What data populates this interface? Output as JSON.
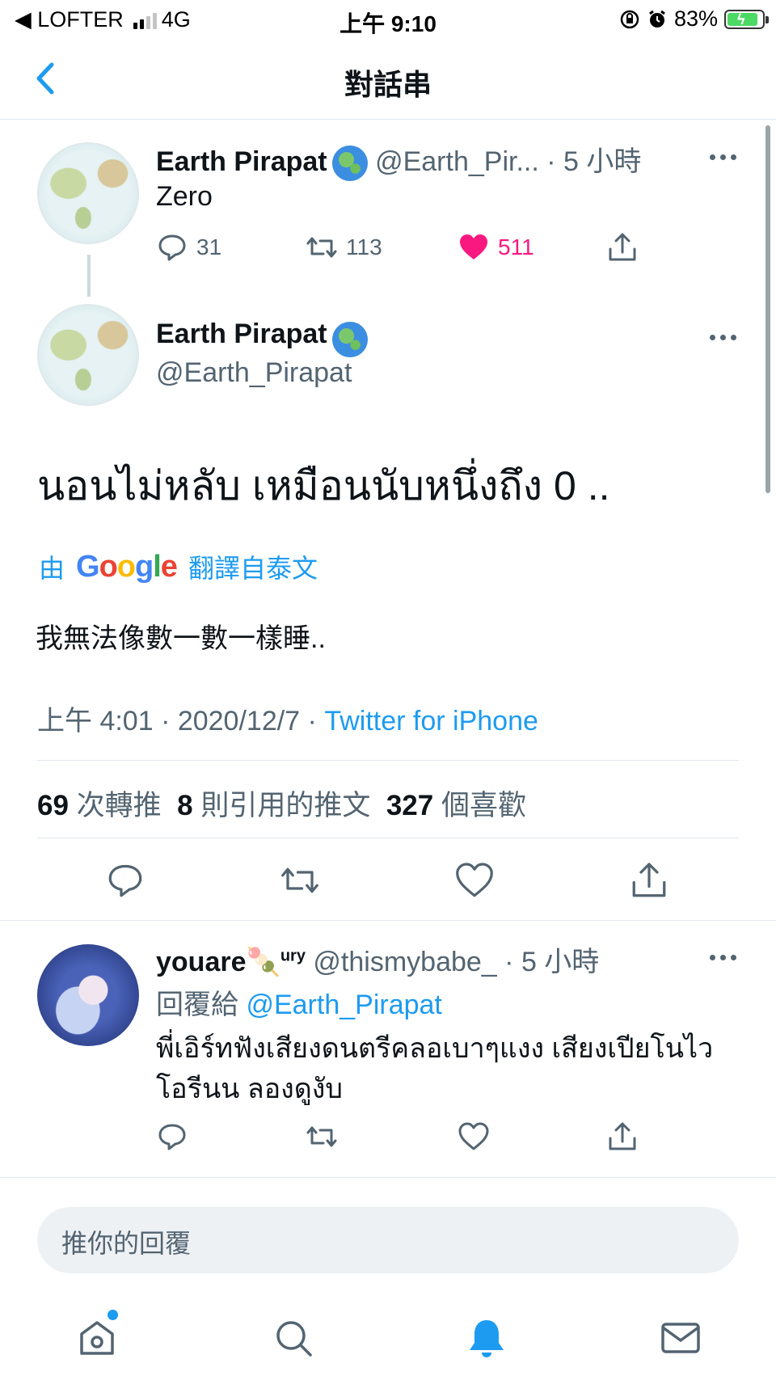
{
  "status_bar": {
    "carrier": "◀ LOFTER",
    "network": "4G",
    "time": "上午 9:10",
    "battery": "83%"
  },
  "nav": {
    "title": "對話串"
  },
  "thread_tweet": {
    "name": "Earth Pirapat",
    "handle": "@Earth_Pir...",
    "time": "· 5 小時",
    "text": "Zero",
    "replies": "31",
    "retweets": "113",
    "likes": "511"
  },
  "main_tweet": {
    "name": "Earth Pirapat",
    "handle": "@Earth_Pirapat",
    "text": "นอนไม่หลับ เหมือนนับหนึ่งถึง 0 ..",
    "translate_prefix": "由",
    "translate_brand": "Google",
    "translate_suffix": "翻譯自泰文",
    "translation": "我無法像數一數一樣睡..",
    "timestamp": "上午 4:01 · 2020/12/7 ·",
    "source": "Twitter for iPhone",
    "stats": {
      "retweets_count": "69",
      "retweets_label": "次轉推",
      "quotes_count": "8",
      "quotes_label": "則引用的推文",
      "likes_count": "327",
      "likes_label": "個喜歡"
    }
  },
  "reply_tweet": {
    "name": "youare",
    "emoji": "🍡",
    "name_suffix": "ury",
    "handle": "@thismybabe_",
    "time": "· 5 小時",
    "reply_to_label": "回覆給",
    "reply_to_handle": "@Earth_Pirapat",
    "text": "พี่เอิร์ทฟังเสียงดนตรีคลอเบาๆแงง เสียงเปียโนไวโอรีนน ลองดูงับ"
  },
  "reply_input": {
    "placeholder": "推你的回覆"
  },
  "tabbar": {
    "tabs": [
      "home",
      "search",
      "notifications",
      "messages"
    ],
    "active": "notifications",
    "accent": "#1d9bf0"
  },
  "colors": {
    "accent": "#1d9bf0",
    "like": "#f91880",
    "muted": "#536471"
  }
}
